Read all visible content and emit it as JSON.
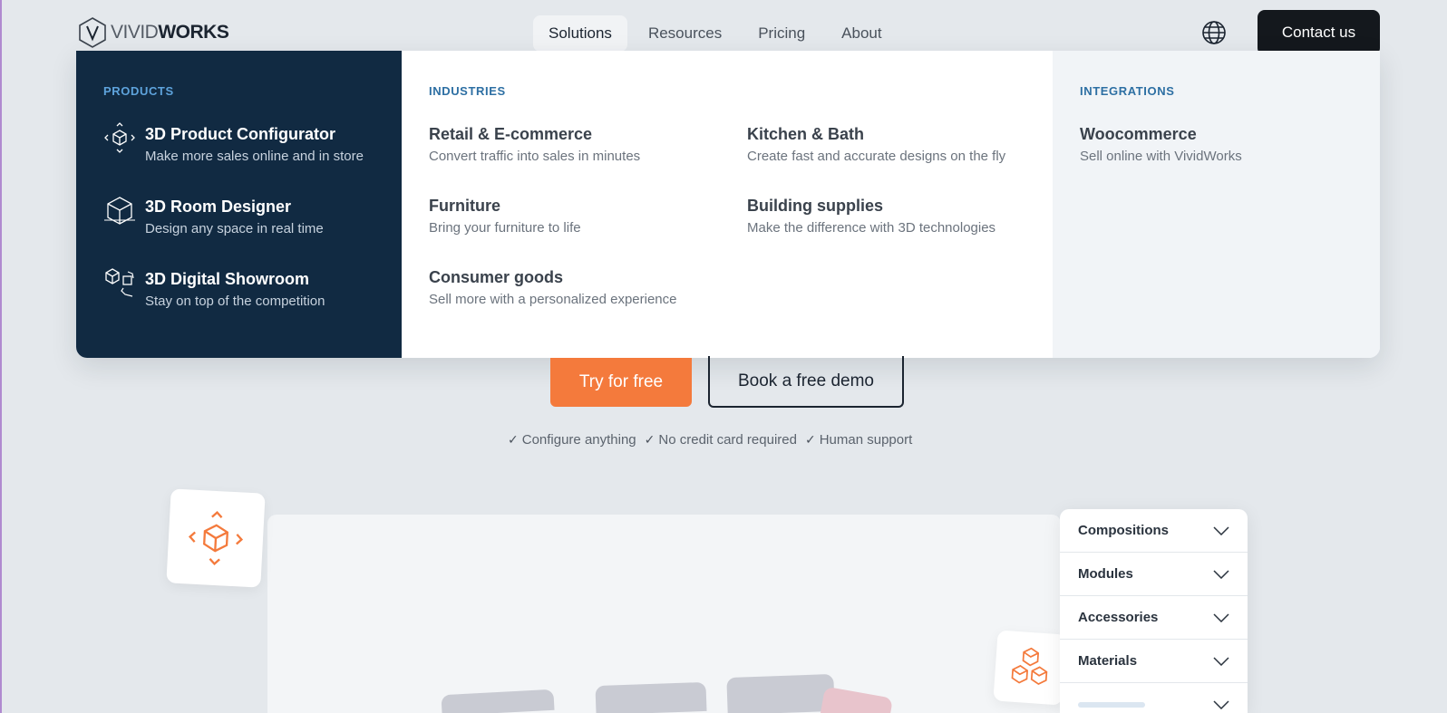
{
  "brand": {
    "name_part1": "VIVID",
    "name_part2": "WORKS"
  },
  "nav": {
    "items": [
      {
        "label": "Solutions",
        "active": true
      },
      {
        "label": "Resources",
        "active": false
      },
      {
        "label": "Pricing",
        "active": false
      },
      {
        "label": "About",
        "active": false
      }
    ],
    "contact_label": "Contact us",
    "globe_icon": "globe-icon"
  },
  "mega_menu": {
    "products": {
      "heading": "PRODUCTS",
      "items": [
        {
          "title": "3D Product Configurator",
          "subtitle": "Make more sales online and in store",
          "icon": "rotate-cube-icon"
        },
        {
          "title": "3D Room Designer",
          "subtitle": "Design any space in real time",
          "icon": "room-cube-icon"
        },
        {
          "title": "3D Digital Showroom",
          "subtitle": "Stay on top of the competition",
          "icon": "showroom-icon"
        }
      ]
    },
    "industries": {
      "heading": "INDUSTRIES",
      "items": [
        {
          "title": "Retail & E-commerce",
          "subtitle": "Convert traffic into sales in minutes"
        },
        {
          "title": "Kitchen & Bath",
          "subtitle": "Create fast and accurate designs on the fly"
        },
        {
          "title": "Furniture",
          "subtitle": "Bring your furniture to life"
        },
        {
          "title": "Building supplies",
          "subtitle": "Make the difference with 3D technologies"
        },
        {
          "title": "Consumer goods",
          "subtitle": "Sell more with a personalized experience"
        }
      ]
    },
    "integrations": {
      "heading": "INTEGRATIONS",
      "items": [
        {
          "title": "Woocommerce",
          "subtitle": "Sell online with VividWorks"
        }
      ]
    }
  },
  "hero": {
    "try_label": "Try for free",
    "demo_label": "Book a free demo",
    "features": [
      "Configure anything",
      "No credit card required",
      "Human support"
    ]
  },
  "configurator_panel": {
    "rows": [
      "Compositions",
      "Modules",
      "Accessories",
      "Materials"
    ]
  },
  "colors": {
    "accent": "#f47a3c",
    "menu_dark": "#112a42",
    "background": "#e4e8ec"
  }
}
